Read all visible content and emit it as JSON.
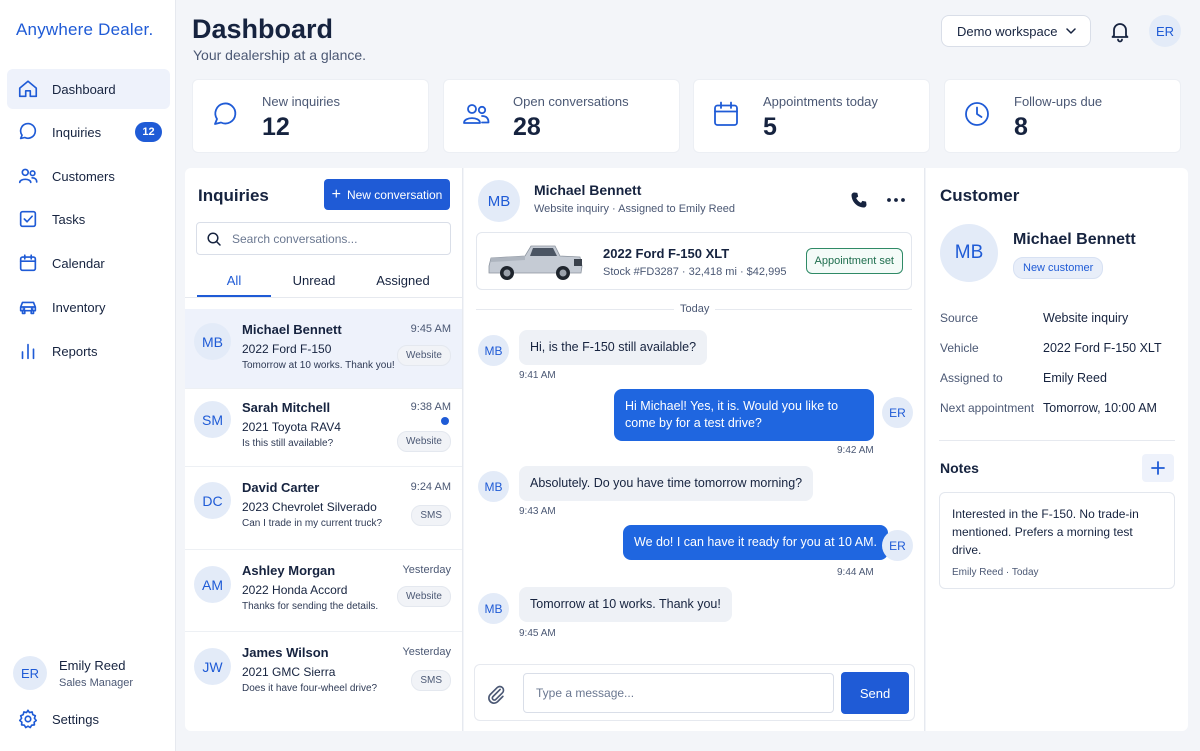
{
  "app": {
    "brand": "Anywhere Dealer."
  },
  "sidebar": {
    "items": [
      {
        "label": "Dashboard"
      },
      {
        "label": "Inquiries",
        "badge": "12"
      },
      {
        "label": "Customers"
      },
      {
        "label": "Tasks"
      },
      {
        "label": "Calendar"
      },
      {
        "label": "Inventory"
      },
      {
        "label": "Reports"
      }
    ],
    "user": {
      "initials": "ER",
      "name": "Emily Reed",
      "role": "Sales Manager"
    },
    "settings_label": "Settings"
  },
  "header": {
    "title": "Dashboard",
    "subtitle": "Your dealership at a glance.",
    "workspace": "Demo workspace",
    "avatar": "ER"
  },
  "stats": [
    {
      "label": "New inquiries",
      "value": "12",
      "icon": "chat-bubble-icon"
    },
    {
      "label": "Open conversations",
      "value": "28",
      "icon": "users-icon"
    },
    {
      "label": "Appointments today",
      "value": "5",
      "icon": "calendar-icon"
    },
    {
      "label": "Follow-ups due",
      "value": "8",
      "icon": "clock-icon"
    }
  ],
  "inquiries": {
    "title": "Inquiries",
    "new_button": "New conversation",
    "search_placeholder": "Search conversations...",
    "tabs": [
      "All",
      "Unread",
      "Assigned"
    ],
    "conversations": [
      {
        "initials": "MB",
        "name": "Michael Bennett",
        "vehicle": "2022 Ford F-150",
        "message": "Tomorrow at 10 works. Thank you!",
        "time": "9:45 AM",
        "tag": "Website"
      },
      {
        "initials": "SM",
        "name": "Sarah Mitchell",
        "vehicle": "2021 Toyota RAV4",
        "message": "Is this still available?",
        "time": "9:38 AM",
        "tag": "Website"
      },
      {
        "initials": "DC",
        "name": "David Carter",
        "vehicle": "2023 Chevrolet Silverado",
        "message": "Can I trade in my current truck?",
        "time": "9:24 AM",
        "tag": "SMS"
      },
      {
        "initials": "AM",
        "name": "Ashley Morgan",
        "vehicle": "2022 Honda Accord",
        "message": "Thanks for sending the details.",
        "time": "Yesterday",
        "tag": "Website"
      },
      {
        "initials": "JW",
        "name": "James Wilson",
        "vehicle": "2021 GMC Sierra",
        "message": "Does it have four-wheel drive?",
        "time": "Yesterday",
        "tag": "SMS"
      }
    ]
  },
  "chat": {
    "initials": "MB",
    "name": "Michael Bennett",
    "subtitle": "Website inquiry  ·  Assigned to Emily Reed",
    "vehicle": {
      "title": "2022 Ford F-150 XLT",
      "meta": "Stock #FD3287  ·  32,418 mi  ·  $42,995",
      "status": "Appointment set"
    },
    "day_label": "Today",
    "messages": [
      {
        "from": "MB",
        "text": "Hi, is the F-150 still available?",
        "time": "9:41 AM"
      },
      {
        "from": "ER",
        "text": "Hi Michael! Yes, it is. Would you like to come by for a test drive?",
        "time": "9:42 AM"
      },
      {
        "from": "MB",
        "text": "Absolutely. Do you have time tomorrow morning?",
        "time": "9:43 AM"
      },
      {
        "from": "ER",
        "text": "We do! I can have it ready for you at 10 AM.",
        "time": "9:44 AM"
      },
      {
        "from": "MB",
        "text": "Tomorrow at 10 works. Thank you!",
        "time": "9:45 AM"
      }
    ],
    "input_placeholder": "Type a message...",
    "send_label": "Send"
  },
  "customer": {
    "title": "Customer",
    "initials": "MB",
    "name": "Michael Bennett",
    "badge": "New customer",
    "details": [
      {
        "key": "Source",
        "value": "Website inquiry"
      },
      {
        "key": "Vehicle",
        "value": "2022 Ford F-150 XLT"
      },
      {
        "key": "Assigned to",
        "value": "Emily Reed"
      },
      {
        "key": "Next appointment",
        "value": "Tomorrow, 10:00 AM"
      }
    ],
    "notes_title": "Notes",
    "note": {
      "text": "Interested in the F-150. No trade-in mentioned. Prefers a morning test drive.",
      "meta": "Emily Reed · Today"
    }
  },
  "colors": {
    "accent": "#1f5bd6",
    "outgoing_bubble": "#1f66e0",
    "incoming_bubble": "#eef1f6",
    "appointment_badge": "#2f8a66"
  }
}
